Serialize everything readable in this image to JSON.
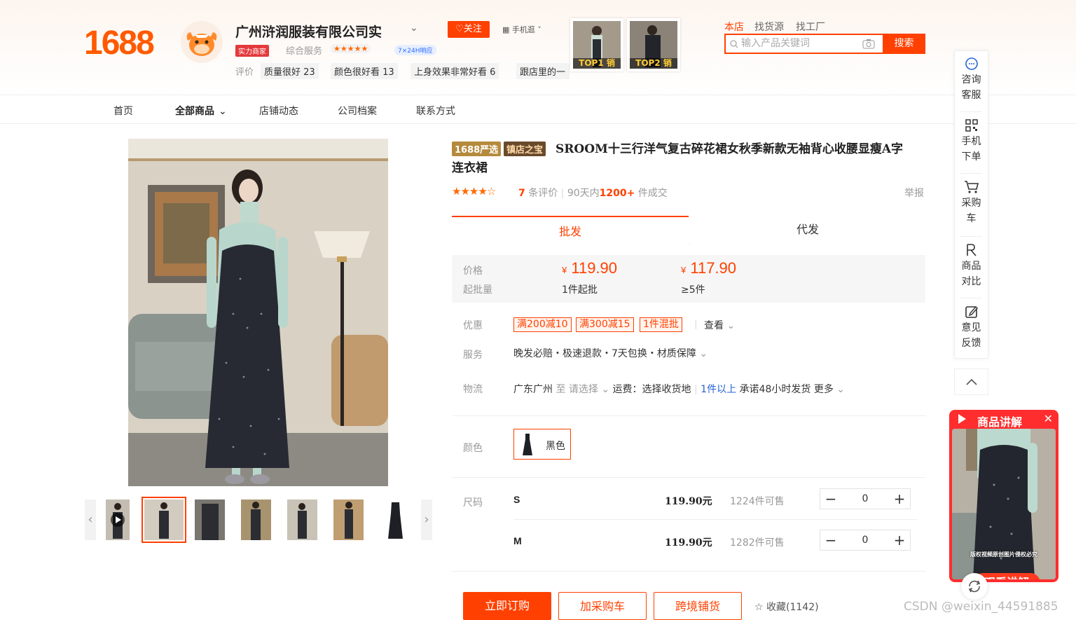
{
  "header": {
    "logo": "1688",
    "shop_name": "广州浒润服装有限公司实",
    "follow_label": "♡关注",
    "mobile_shop_label": "手机逛",
    "strength_badge": "实力商家",
    "service_label": "综合服务",
    "service_stars": "★★★★★",
    "response_badge": "7×24H响应",
    "review_label": "评价",
    "review_tags": [
      "质量很好 23",
      "颜色很好看 13",
      "上身效果非常好看 6",
      "跟店里的一"
    ],
    "top_items": [
      "TOP1 销",
      "TOP2 销"
    ],
    "search_tabs": [
      "本店",
      "找货源",
      "找工厂"
    ],
    "search_placeholder": "输入产品关键词",
    "search_button": "搜索"
  },
  "nav": {
    "items": [
      "首页",
      "全部商品",
      "店铺动态",
      "公司档案",
      "联系方式"
    ]
  },
  "product": {
    "badge_yanxuan": "1688严选",
    "badge_zhendian": "镇店之宝",
    "title": "SROOM十三行洋气复古碎花裙女秋季新款无袖背心收腰显瘦A字连衣裙",
    "rating_stars": "★★★★☆",
    "review_count": "7",
    "review_suffix": "条评价",
    "sales_prefix": "90天内",
    "sales_count": "1200+",
    "sales_suffix": "件成交",
    "report_label": "举报",
    "rating": 4,
    "rating_max": 5
  },
  "tabs": {
    "wholesale": "批发",
    "dropship": "代发"
  },
  "pricing": {
    "price_label": "价格",
    "moq_label": "起批量",
    "currency": "¥",
    "tiers": [
      {
        "price": "119.90",
        "moq": "1件起批"
      },
      {
        "price": "117.90",
        "moq": "≥5件"
      }
    ]
  },
  "promotions": {
    "label": "优惠",
    "tags": [
      "满200减10",
      "满300减15",
      "1件混批"
    ],
    "more": "查看"
  },
  "service": {
    "label": "服务",
    "text": "晚发必赔・极速退款・7天包换・材质保障"
  },
  "logistics": {
    "label": "物流",
    "origin": "广东广州",
    "to": "至",
    "destination": "请选择",
    "shipping": "运费：选择收货地",
    "qty_rule": "1件以上",
    "promise": "承诺48小时发货",
    "more": "更多"
  },
  "color": {
    "label": "颜色",
    "option": "黑色"
  },
  "sizes": {
    "label": "尺码",
    "rows": [
      {
        "name": "S",
        "price": "119.90元",
        "stock": "1224件可售",
        "qty": "0"
      },
      {
        "name": "M",
        "price": "119.90元",
        "stock": "1282件可售",
        "qty": "0"
      }
    ]
  },
  "actions": {
    "order_now": "立即订购",
    "add_cart": "加采购车",
    "cross_border": "跨境铺货",
    "favorite": "收藏(1142)"
  },
  "sidebar": {
    "items": [
      {
        "icon": "chat-icon",
        "label1": "咨询",
        "label2": "客服"
      },
      {
        "icon": "qrcode-icon",
        "label1": "手机",
        "label2": "下单"
      },
      {
        "icon": "cart-icon",
        "label1": "采购",
        "label2": "车"
      },
      {
        "icon": "compare-icon",
        "label1": "商品",
        "label2": "对比"
      },
      {
        "icon": "feedback-icon",
        "label1": "意见",
        "label2": "反馈"
      }
    ]
  },
  "live": {
    "title": "商品讲解",
    "watch": "观看讲解",
    "caption": "版权视频原创图片侵权必究"
  },
  "watermark": "CSDN @weixin_44591885",
  "colors": {
    "accent": "#ff4000",
    "brand_logo": "#ff5a00"
  }
}
